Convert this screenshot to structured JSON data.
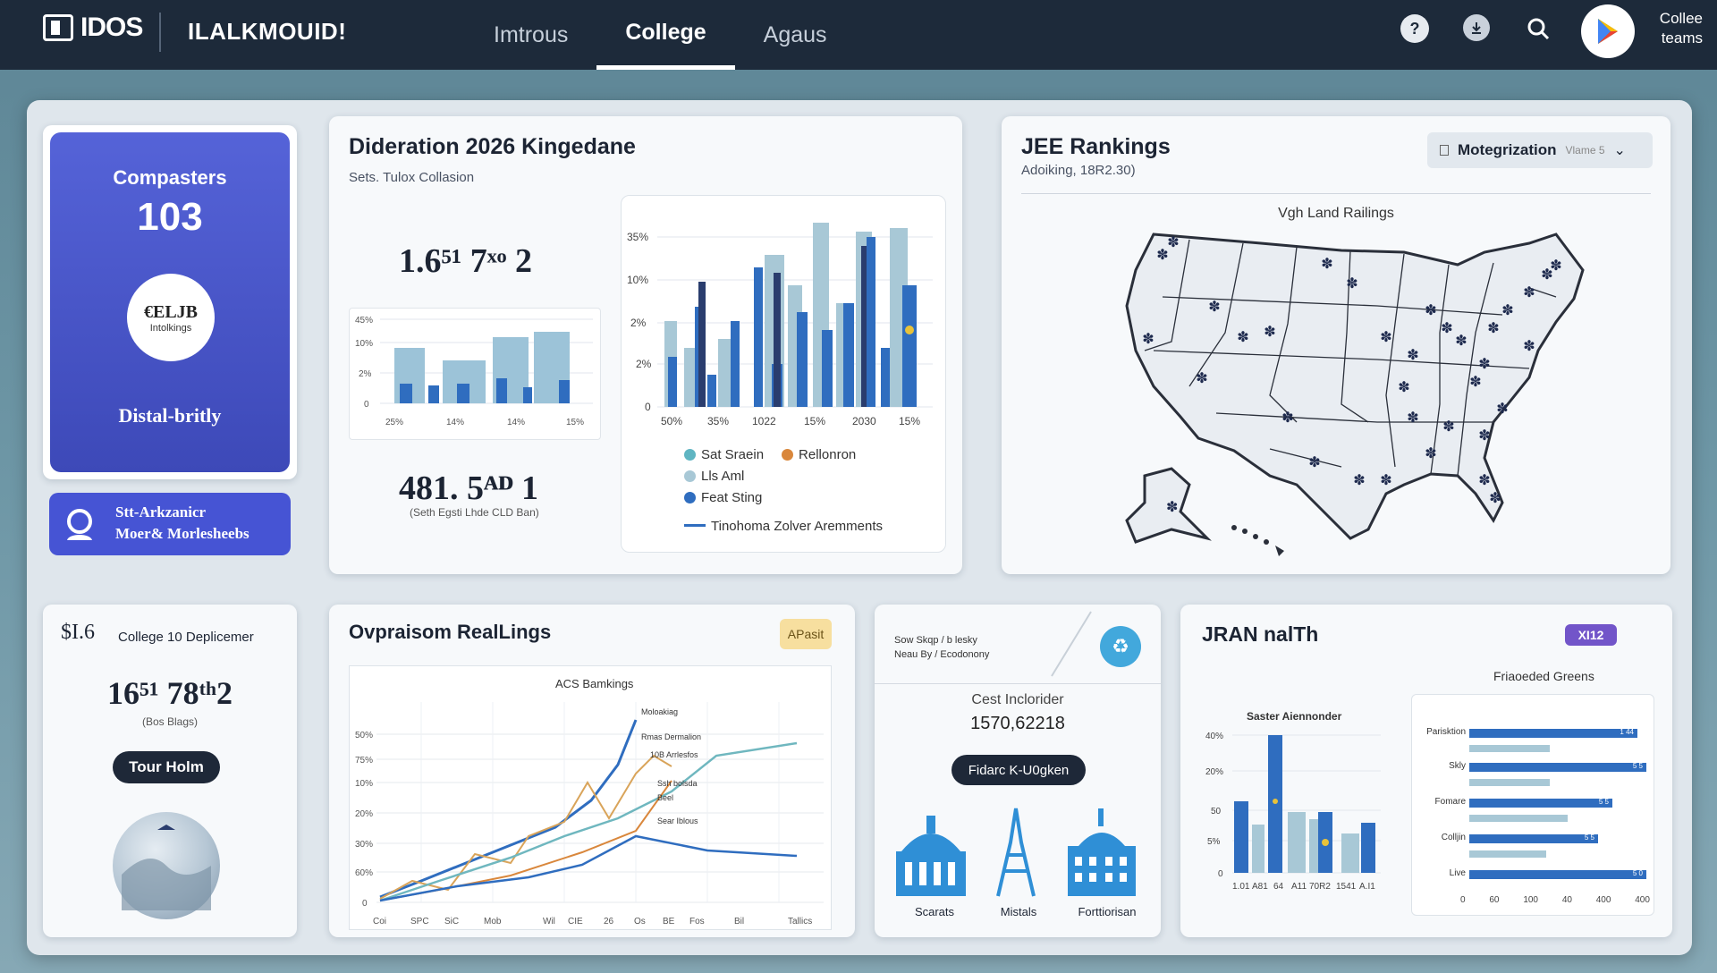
{
  "topbar": {
    "logo_text": "IDOS",
    "brand": "ILALKMOUID!",
    "tabs": [
      {
        "label": "Imtrous"
      },
      {
        "label": "College",
        "active": true
      },
      {
        "label": "Agaus"
      }
    ],
    "account_label": "Collee teams",
    "icons": [
      "help-icon",
      "download-icon",
      "search-icon",
      "play-store-icon"
    ]
  },
  "profile": {
    "title": "Compasters",
    "count": "103",
    "badge_main": "€ELJB",
    "badge_sub": "Intolkings",
    "footer": "Distal-britly",
    "action_line1": "Stt-Arkzanicr",
    "action_line2": "Moer& Morlesheebs"
  },
  "dideration": {
    "title": "Dideration 2026 Kingedane",
    "subtitle": "Sets. Tulox Collasion",
    "stat1": "1.6⁵¹ 7ˣᵒ 2",
    "stat2": "481. 5ᴬᴰ 1",
    "stat2_note": "(Seth Egsti Lhde CLD Ban)",
    "mini_chart": {
      "y_ticks": [
        "45%",
        "10%",
        "2%",
        "0"
      ],
      "x_ticks": [
        "25%",
        "14%",
        "14%",
        "15%"
      ]
    },
    "main_chart": {
      "y_ticks": [
        "35%",
        "10%",
        "2%",
        "2%",
        "0"
      ],
      "x_ticks": [
        "50%",
        "35%",
        "1022",
        "15%",
        "2030",
        "15%"
      ]
    },
    "legend": [
      {
        "label": "Sat Sraein",
        "color": "#5fb5c2"
      },
      {
        "label": "Rellonron",
        "color": "#d9873c"
      },
      {
        "label": "Lls Aml",
        "color": "#a8c8d6"
      },
      {
        "label": "Feat Sting",
        "color": "#2f6dbf"
      }
    ],
    "legend_line": "Tinohoma Zolver Aremments"
  },
  "jee": {
    "title": "JEE Rankings",
    "subtitle": "Adoiking, 18R2.30)",
    "dropdown_label": "Motegrization",
    "dropdown_hint": "Vlame 5",
    "map_title": "Vgh Land Railings",
    "marker_color": "#1e2a4e"
  },
  "college_card": {
    "header_prefix": "$I.6",
    "header_label": "College 10 Deplicemer",
    "stat": "16⁵¹ 78ᵗʰ2",
    "stat_note": "(Bos Blags)",
    "button": "Tour Holm"
  },
  "ovpraisom": {
    "title": "Ovpraisom RealLings",
    "badge": "APasit",
    "chart_title": "ACS Bamkings",
    "y_ticks": [
      "50%",
      "75%",
      "10%",
      "20%",
      "30%",
      "60%",
      "0"
    ],
    "x_ticks": [
      "Coi",
      "SPC",
      "SiC",
      "Mob",
      "Wil",
      "CIE",
      "26",
      "Os",
      "BE",
      "Fos",
      "Bil",
      "Tallics"
    ],
    "series_labels": [
      "Moloakiag",
      "Rmas Dermalion",
      "10B Arrlesfos",
      "Ssh bolsda",
      "Beel",
      "Sear Iblous"
    ]
  },
  "scholarship": {
    "header_line1": "Sow Skqp / b lesky",
    "header_line2": "Neau By / Ecodonony",
    "label": "Cest Inclorider",
    "value": "1570,62218",
    "button": "Fidarc K-U0gken",
    "landmarks": [
      {
        "label": "Scarats"
      },
      {
        "label": "Mistals"
      },
      {
        "label": "Forttiorisan"
      }
    ]
  },
  "jran": {
    "title": "JRAN nalTh",
    "badge": "XI12",
    "bar_title": "Saster Aiennonder",
    "bar_y_ticks": [
      "40%",
      "20%",
      "50",
      "5%",
      "0"
    ],
    "bar_x_ticks": [
      "1.01",
      "A81",
      "64",
      "A11",
      "70R2",
      "1541",
      "A.I1"
    ],
    "hbar_title": "Friaoeded Greens",
    "hbar_rows": [
      {
        "label": "Parisktion",
        "value": "1 44"
      },
      {
        "label": "Skly",
        "value": "5 5"
      },
      {
        "label": "Fomare",
        "value": "5 5"
      },
      {
        "label": "Colljin",
        "value": "5 5"
      },
      {
        "label": "Live",
        "value": "5 0"
      }
    ],
    "hbar_x_ticks": [
      "0",
      "60",
      "100",
      "40",
      "400",
      "400"
    ]
  },
  "colors": {
    "accent": "#4b5fd6",
    "dark": "#1d2a3a",
    "blue": "#2f6dbf",
    "light_blue": "#a8c8d6",
    "orange": "#d9873c",
    "teal": "#5fb5c2",
    "purple": "#6c52c7"
  }
}
